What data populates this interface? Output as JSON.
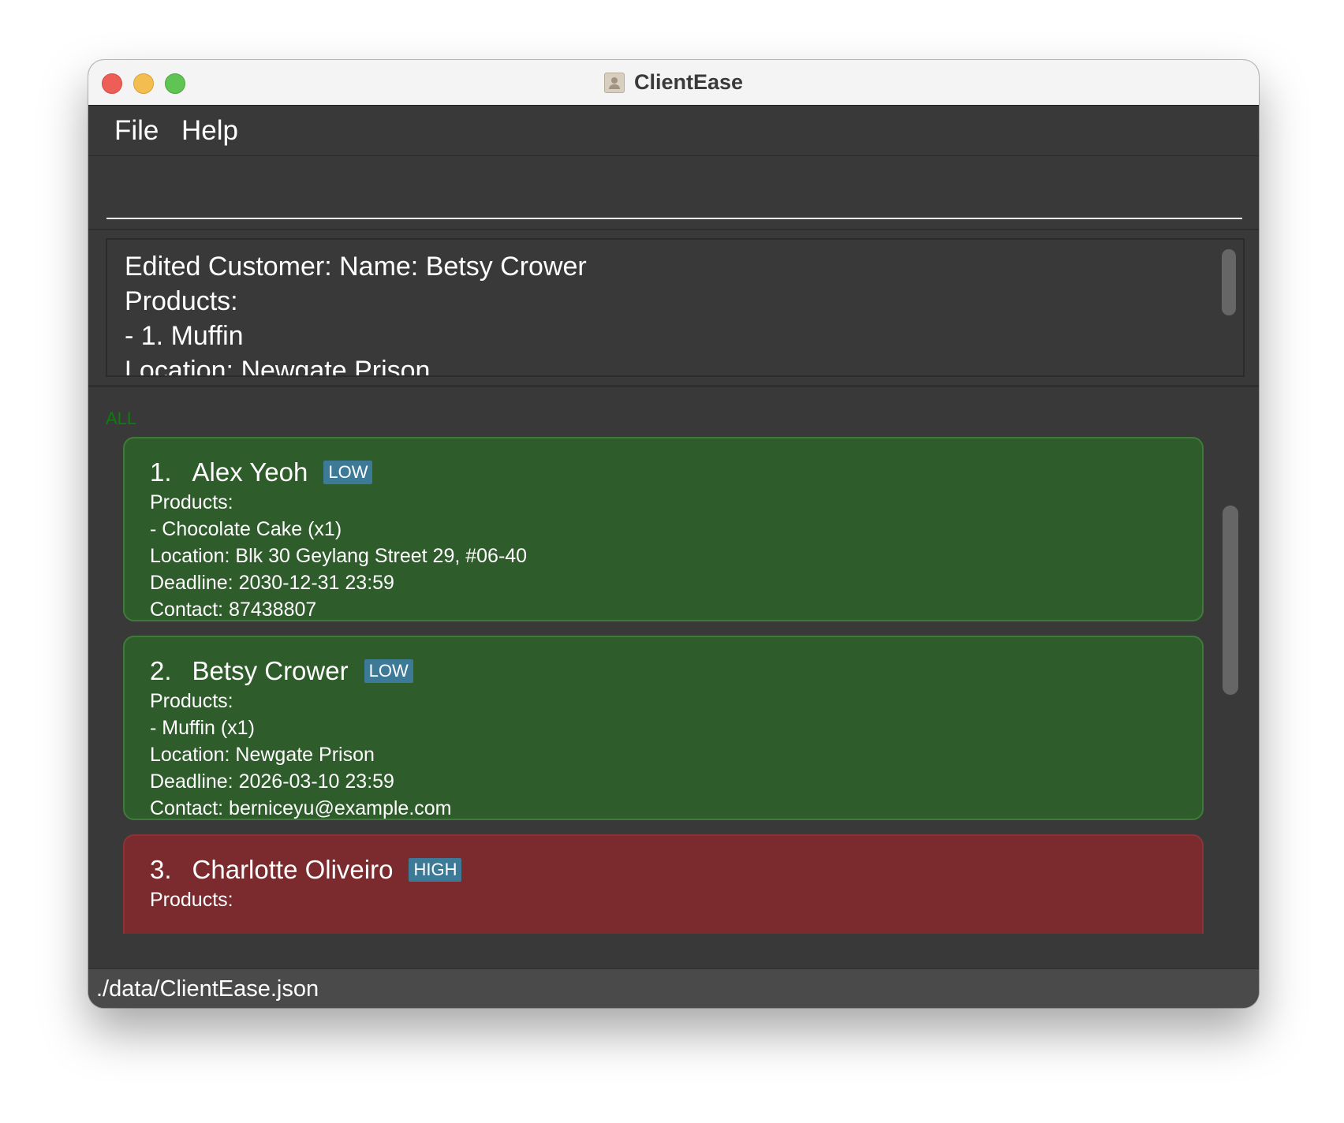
{
  "window": {
    "title": "ClientEase",
    "icon": "contact-book-icon"
  },
  "menu": {
    "file_label": "File",
    "help_label": "Help"
  },
  "command": {
    "value": "",
    "placeholder": ""
  },
  "result": {
    "text": "Edited Customer: Name: Betsy Crower\nProducts:\n- 1. Muffin\nLocation: Newgate Prison"
  },
  "filter": {
    "label": "ALL",
    "color": "#0d7d0d"
  },
  "customers": [
    {
      "index": "1.",
      "name": "Alex Yeoh",
      "priority": "LOW",
      "products_label": "Products:",
      "products": "- Chocolate Cake (x1)",
      "location": "Location: Blk 30 Geylang Street 29, #06-40",
      "deadline": "Deadline: 2030-12-31 23:59",
      "contact": "Contact: 87438807"
    },
    {
      "index": "2.",
      "name": "Betsy Crower",
      "priority": "LOW",
      "products_label": "Products:",
      "products": "- Muffin (x1)",
      "location": "Location: Newgate Prison",
      "deadline": "Deadline: 2026-03-10 23:59",
      "contact": "Contact: berniceyu@example.com"
    },
    {
      "index": "3.",
      "name": "Charlotte Oliveiro",
      "priority": "HIGH",
      "products_label": "Products:"
    }
  ],
  "colors": {
    "low_card": "#2e5c2a",
    "high_card": "#7b2a2d",
    "badge": "#3c7a98",
    "background": "#393939"
  },
  "status": {
    "path": "./data/ClientEase.json"
  }
}
